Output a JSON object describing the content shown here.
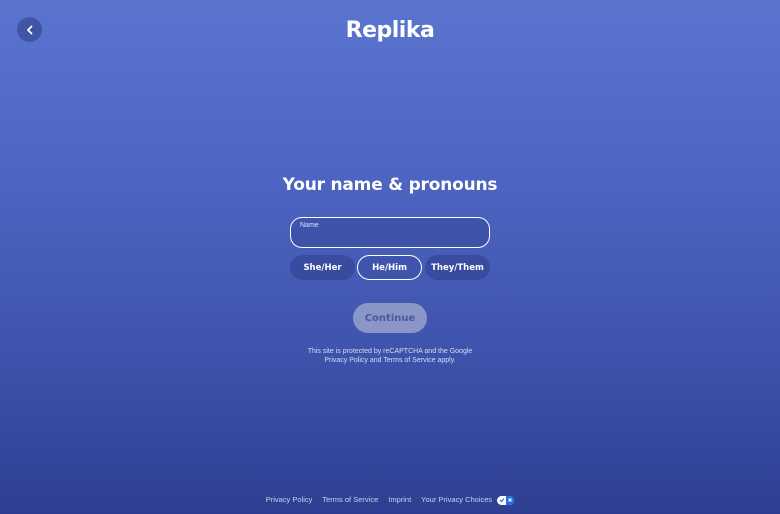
{
  "header": {
    "logo_text": "Replika",
    "back_icon": "chevron-left-icon"
  },
  "main": {
    "title": "Your name & pronouns",
    "name_field": {
      "label": "Name",
      "value": ""
    },
    "pronouns": [
      {
        "label": "She/Her",
        "selected": false
      },
      {
        "label": "He/Him",
        "selected": true
      },
      {
        "label": "They/Them",
        "selected": false
      }
    ],
    "continue_label": "Continue",
    "recaptcha": {
      "line1": "This site is protected by reCAPTCHA and the Google",
      "privacy_policy": "Privacy Policy",
      "and": "and",
      "terms": "Terms of Service",
      "apply": "apply."
    }
  },
  "footer": {
    "links": [
      "Privacy Policy",
      "Terms of Service",
      "Imprint",
      "Your Privacy Choices"
    ],
    "privacy_toggle_icon": "privacy-choices-toggle-icon"
  },
  "colors": {
    "background_top": "#5a74cf",
    "background_bottom": "#2e3f92",
    "continue_bg": "#8a96c8",
    "toggle_blue": "#1f6feb"
  }
}
